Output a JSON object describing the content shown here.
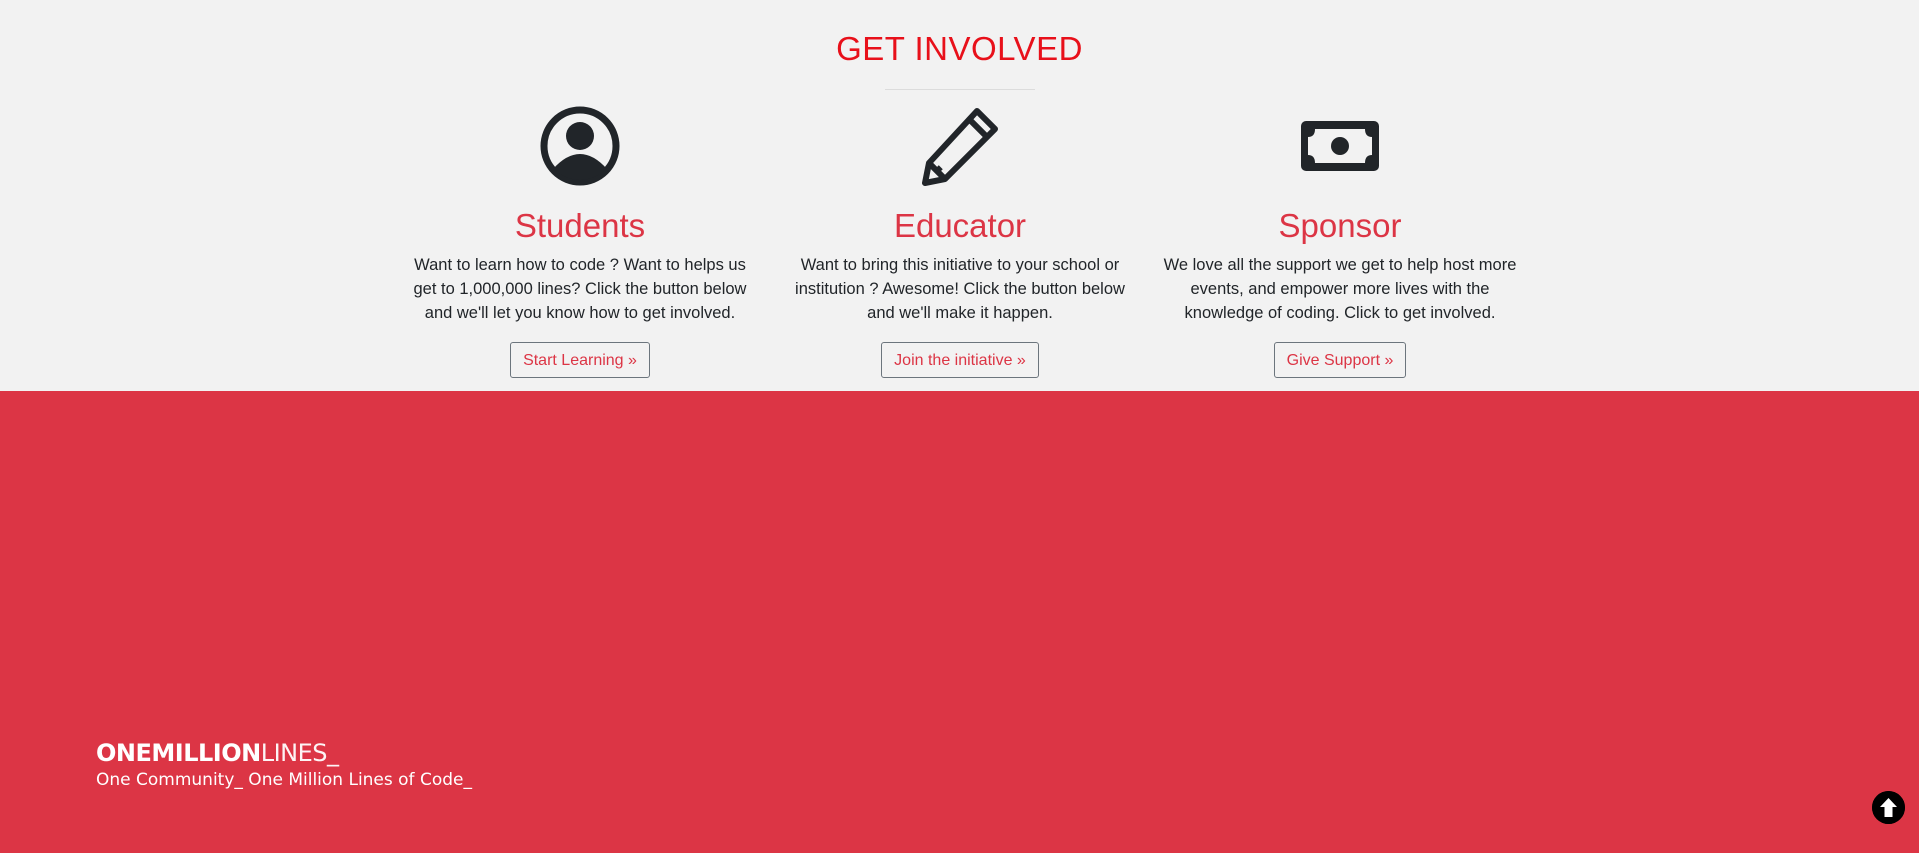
{
  "involved": {
    "title": "GET INVOLVED",
    "columns": [
      {
        "icon": "user-circle-icon",
        "heading": "Students",
        "text": "Want to learn how to code ? Want to helps us get to 1,000,000 lines? Click the button below and we'll let you know how to get involved.",
        "button": "Start Learning »"
      },
      {
        "icon": "pencil-icon",
        "heading": "Educator",
        "text": "Want to bring this initiative to your school or institution ? Awesome! Click the button below and we'll make it happen.",
        "button": "Join the initiative »"
      },
      {
        "icon": "money-bill-icon",
        "heading": "Sponsor",
        "text": "We love all the support we get to help host more events, and empower more lives with the knowledge of coding. Click to get involved.",
        "button": "Give Support »"
      }
    ]
  },
  "footer": {
    "brand_bold": "ONEMILLION",
    "brand_light": "LINES_",
    "tagline": "One Community_ One Million Lines of Code_",
    "to_top_icon": "arrow-up-circle-icon"
  },
  "colors": {
    "title_red": "#e8101a",
    "accent_red": "#dc3545",
    "section_bg": "#f2f2f2",
    "icon_dark": "#212529"
  }
}
